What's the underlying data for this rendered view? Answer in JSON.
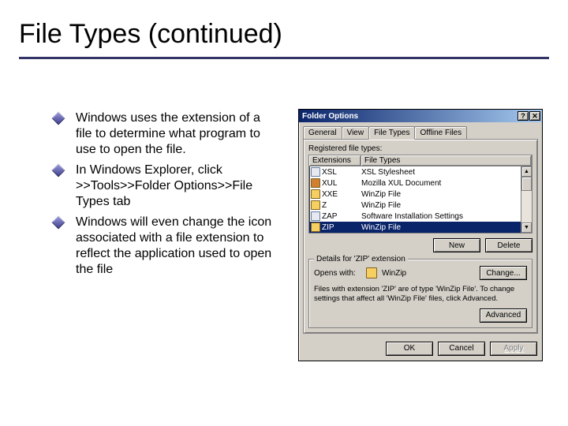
{
  "title": "File Types (continued)",
  "bullets": [
    "Windows uses the extension of a file to determine what program to use to open the file.",
    "In Windows Explorer, click >>Tools>>Folder Options>>File Types tab",
    "Windows will even change the icon associated with a file extension to reflect the application used to open the file"
  ],
  "dialog": {
    "title": "Folder Options",
    "close_help": "?",
    "close_x": "✕",
    "tabs": [
      "General",
      "View",
      "File Types",
      "Offline Files"
    ],
    "active_tab": 2,
    "section_label": "Registered file types:",
    "headers": {
      "ext": "Extensions",
      "type": "File Types"
    },
    "rows": [
      {
        "ext": "XSL",
        "type": "XSL Stylesheet",
        "icon": "doc"
      },
      {
        "ext": "XUL",
        "type": "Mozilla XUL Document",
        "icon": "xul"
      },
      {
        "ext": "XXE",
        "type": "WinZip File",
        "icon": "zip"
      },
      {
        "ext": "Z",
        "type": "WinZip File",
        "icon": "zip"
      },
      {
        "ext": "ZAP",
        "type": "Software Installation Settings",
        "icon": "doc"
      },
      {
        "ext": "ZIP",
        "type": "WinZip File",
        "icon": "zip",
        "selected": true
      }
    ],
    "buttons": {
      "new": "New",
      "delete": "Delete",
      "change": "Change...",
      "advanced": "Advanced"
    },
    "details": {
      "group_title": "Details for 'ZIP' extension",
      "opens_label": "Opens with:",
      "opens_app": "WinZip",
      "hint": "Files with extension 'ZIP' are of type 'WinZip File'. To change settings that affect all 'WinZip File' files, click Advanced."
    },
    "footer": {
      "ok": "OK",
      "cancel": "Cancel",
      "apply": "Apply"
    }
  }
}
